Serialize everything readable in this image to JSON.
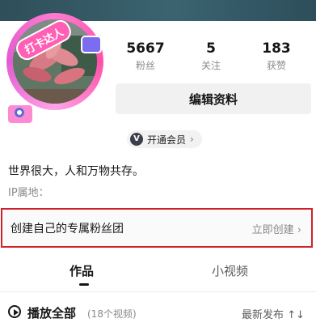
{
  "avatar": {
    "badge_text": "打卡达人"
  },
  "stats": [
    {
      "value": "5667",
      "label": "粉丝"
    },
    {
      "value": "5",
      "label": "关注"
    },
    {
      "value": "183",
      "label": "获赞"
    }
  ],
  "edit_button_label": "编辑资料",
  "vip": {
    "icon": "V",
    "label": "开通会员",
    "chevron": "›"
  },
  "bio": "世界很大，人和万物共存。",
  "ip_label": "IP属地：",
  "fan_club": {
    "title": "创建自己的专属粉丝团",
    "action": "立即创建",
    "chevron": "›"
  },
  "tabs": [
    {
      "label": "作品",
      "active": true
    },
    {
      "label": "小视频",
      "active": false
    }
  ],
  "playlist": {
    "play_all": "播放全部",
    "count": "(18个视频)",
    "sort_label": "最新发布",
    "sort_icon": "↑↓"
  },
  "colors": {
    "highlight_border": "#d0202a",
    "avatar_ring": "#ff7bd0"
  }
}
